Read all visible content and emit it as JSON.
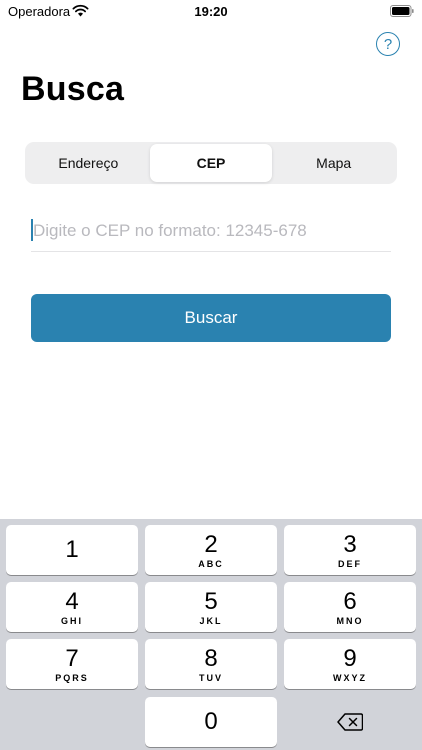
{
  "status_bar": {
    "carrier": "Operadora",
    "time": "19:20",
    "icons": [
      "wifi-icon",
      "battery-icon"
    ]
  },
  "header": {
    "help_icon": "question-circle-icon",
    "help_glyph": "?",
    "title": "Busca"
  },
  "segments": {
    "items": [
      {
        "label": "Endereço"
      },
      {
        "label": "CEP"
      },
      {
        "label": "Mapa"
      }
    ],
    "selected": "CEP"
  },
  "cep_field": {
    "value": "",
    "placeholder": "Digite o CEP no formato: 12345-678"
  },
  "search_button": {
    "label": "Buscar"
  },
  "accent_color": "#2a82b0",
  "keyboard": {
    "keys": [
      {
        "digit": "1",
        "letters": ""
      },
      {
        "digit": "2",
        "letters": "ABC"
      },
      {
        "digit": "3",
        "letters": "DEF"
      },
      {
        "digit": "4",
        "letters": "GHI"
      },
      {
        "digit": "5",
        "letters": "JKL"
      },
      {
        "digit": "6",
        "letters": "MNO"
      },
      {
        "digit": "7",
        "letters": "PQRS"
      },
      {
        "digit": "8",
        "letters": "TUV"
      },
      {
        "digit": "9",
        "letters": "WXYZ"
      },
      {
        "digit": "0",
        "letters": ""
      }
    ],
    "delete_icon": "backspace-icon"
  }
}
